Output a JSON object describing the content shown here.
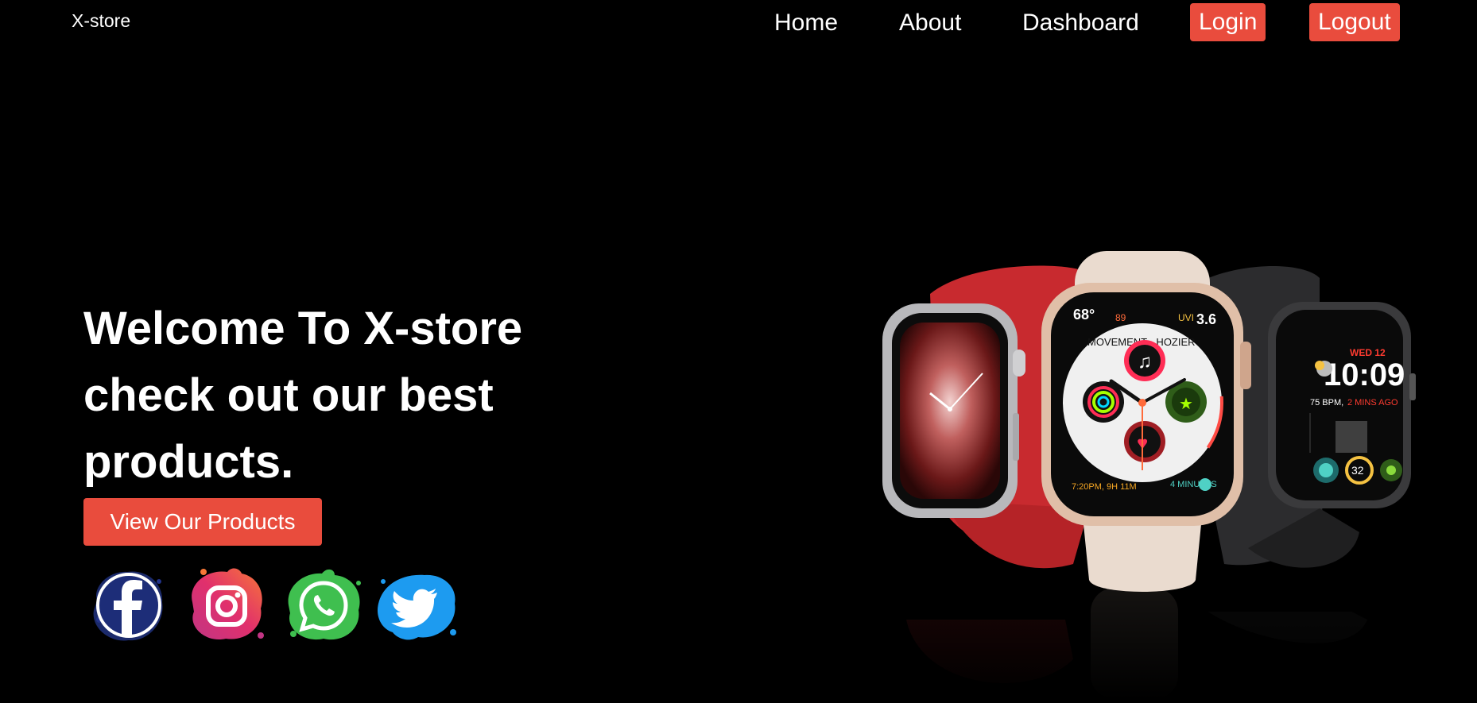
{
  "brand": {
    "name": "X-store"
  },
  "nav": {
    "home": "Home",
    "about": "About",
    "dashboard": "Dashboard",
    "login": "Login",
    "logout": "Logout"
  },
  "hero": {
    "title_lines": [
      "Welcome To X-store",
      "check out our best",
      "products."
    ],
    "cta_label": "View Our Products"
  },
  "social": {
    "icons": [
      "facebook-icon",
      "instagram-icon",
      "whatsapp-icon",
      "twitter-icon"
    ]
  },
  "product_image": {
    "watch_left": {
      "type": "silver aluminum watch with red sport loop"
    },
    "watch_center": {
      "type": "gold watch with pink sand band",
      "face_text": [
        "68°",
        "89",
        "UVI",
        "3.6",
        "MOVEMENT - HOZIER",
        "7:20PM, 9H 11M",
        "4 MINUTES"
      ]
    },
    "watch_right": {
      "type": "space gray watch with black band",
      "face_text": [
        "WED 12",
        "10:09",
        "75 BPM,",
        "2 MINS AGO",
        "32"
      ]
    }
  },
  "colors": {
    "accent": "#e94c3d",
    "background": "#000000",
    "text": "#ffffff"
  }
}
